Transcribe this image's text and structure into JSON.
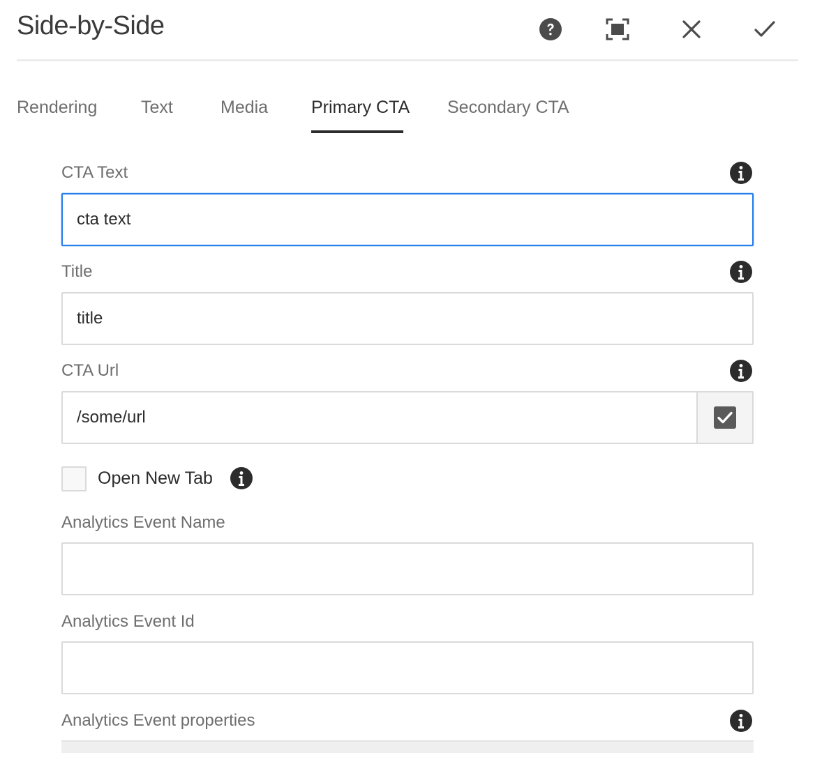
{
  "dialog": {
    "title": "Side-by-Side"
  },
  "header_actions": {
    "help": "help-icon",
    "fullscreen": "fullscreen-icon",
    "close": "close-icon",
    "confirm": "checkmark-icon"
  },
  "tabs": [
    {
      "label": "Rendering",
      "active": false
    },
    {
      "label": "Text",
      "active": false
    },
    {
      "label": "Media",
      "active": false
    },
    {
      "label": "Primary CTA",
      "active": true
    },
    {
      "label": "Secondary CTA",
      "active": false
    }
  ],
  "form": {
    "cta_text": {
      "label": "CTA Text",
      "value": "cta text"
    },
    "title": {
      "label": "Title",
      "value": "title"
    },
    "cta_url": {
      "label": "CTA Url",
      "value": "/some/url"
    },
    "open_new_tab": {
      "label": "Open New Tab",
      "checked": false
    },
    "analytics_event_name": {
      "label": "Analytics Event Name",
      "value": ""
    },
    "analytics_event_id": {
      "label": "Analytics Event Id",
      "value": ""
    },
    "analytics_event_properties": {
      "label": "Analytics Event properties"
    }
  },
  "colors": {
    "focus": "#2680eb",
    "text": "#2c2c2c",
    "label": "#6e6e6e",
    "icon": "#2c2c2c"
  }
}
